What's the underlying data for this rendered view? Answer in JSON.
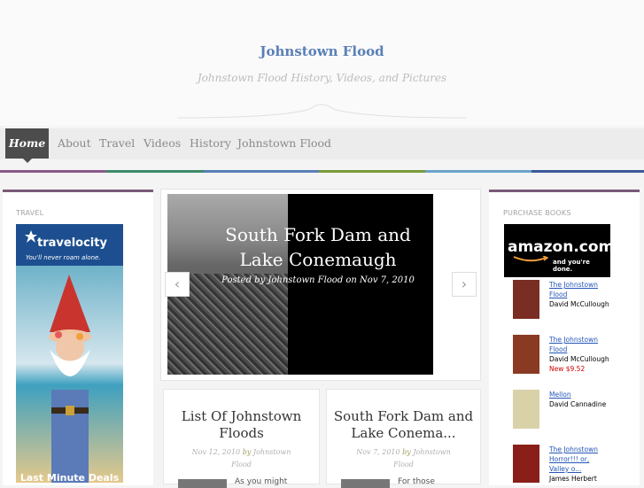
{
  "header": {
    "site_title": "Johnstown Flood",
    "tagline": "Johnstown Flood History, Videos, and Pictures"
  },
  "nav": {
    "items": [
      "Home",
      "About",
      "Travel",
      "Videos",
      "History",
      "Johnstown Flood"
    ],
    "active": "Home"
  },
  "left_sidebar": {
    "section_title": "TRAVEL",
    "ad": {
      "brand": "travelocity",
      "slogan": "You'll never roam alone.",
      "footer": "Last Minute Deals"
    }
  },
  "slider": {
    "title_line1": "South Fork Dam and",
    "title_line2": "Lake Conemaugh",
    "meta": "Posted by Johnstown Flood on Nov 7, 2010",
    "prev_icon": "chevron-left-icon",
    "next_icon": "chevron-right-icon"
  },
  "posts": [
    {
      "title_line1": "List Of Johnstown",
      "title_line2": "Floods",
      "date": "Nov 12, 2010",
      "by": "by",
      "author_line1": "Johnstown",
      "author_line2": "Flood",
      "excerpt": "As you might"
    },
    {
      "title_line1": "South Fork Dam and",
      "title_line2": "Lake Conema...",
      "date": "Nov 7, 2010",
      "by": "by",
      "author_line1": "Johnstown",
      "author_line2": "Flood",
      "excerpt": "For those"
    }
  ],
  "right_sidebar": {
    "section_title": "PURCHASE BOOKS",
    "amazon": {
      "logo": "amazon.com",
      "tagline": "and you're done."
    },
    "books": [
      {
        "title_line1": "The Johnstown",
        "title_line2": "Flood",
        "author": "David McCullough",
        "price": "",
        "cover_color": "#7a2d22"
      },
      {
        "title_line1": "The Johnstown",
        "title_line2": "Flood",
        "author": "David McCullough",
        "price": "New $9.52",
        "cover_color": "#8a3a22"
      },
      {
        "title_line1": "Mellon",
        "title_line2": "",
        "author": "David Cannadine",
        "price": "",
        "cover_color": "#d9d2a8"
      },
      {
        "title_line1": "The Johnstown",
        "title_line2": "Horror!!! or, Valley o...",
        "author": "James Herbert",
        "price": "",
        "cover_color": "#8a1f1a"
      }
    ]
  },
  "colors": {
    "title_blue": "#5a7fb6",
    "nav_active_bg": "#4c4c4c",
    "panel_top_border": "#7b5a78",
    "link_blue": "#2456b8",
    "price_red": "#cc0000"
  }
}
